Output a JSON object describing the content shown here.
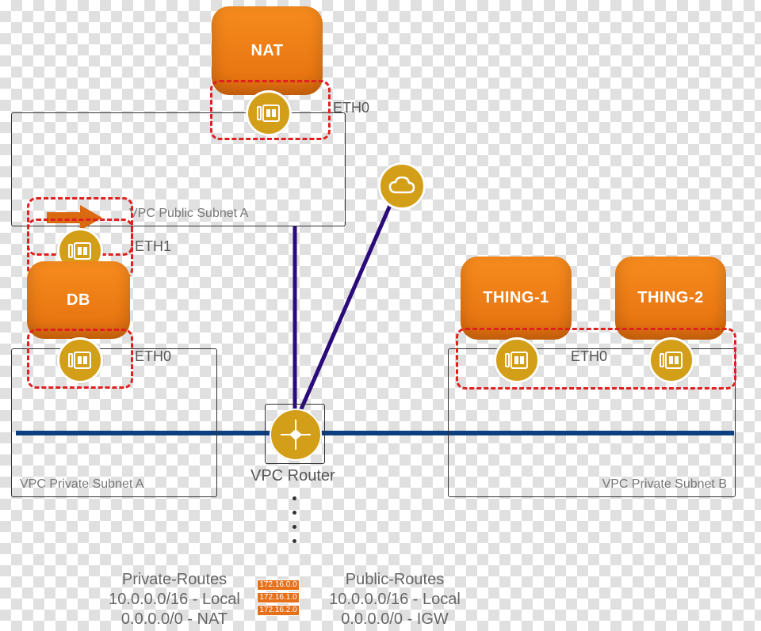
{
  "nodes": {
    "nat": {
      "label": "NAT",
      "eth": "ETH0"
    },
    "db": {
      "label": "DB",
      "eth0": "ETH0",
      "eth1": "ETH1"
    },
    "thing1": {
      "label": "THING-1",
      "eth": "ETH0"
    },
    "thing2": {
      "label": "THING-2"
    }
  },
  "subnets": {
    "publicA": {
      "caption": "VPC Public Subnet A"
    },
    "privateA": {
      "caption": "VPC Private Subnet A"
    },
    "privateB": {
      "caption": "VPC Private Subnet B"
    }
  },
  "router": {
    "label": "VPC Router"
  },
  "routes": {
    "private": {
      "title": "Private-Routes",
      "line1": "10.0.0.0/16 - Local",
      "line2": "0.0.0.0/0 - NAT"
    },
    "public": {
      "title": "Public-Routes",
      "line1": "10.0.0.0/16 - Local",
      "line2": "0.0.0.0/0 - IGW"
    },
    "chips": [
      "172.16.0.0",
      "172.16.1.0",
      "172.16.2.0"
    ]
  },
  "icons": {
    "eni": "network-interface",
    "cloud": "cloud",
    "arrow": "right-arrow",
    "router": "router"
  }
}
